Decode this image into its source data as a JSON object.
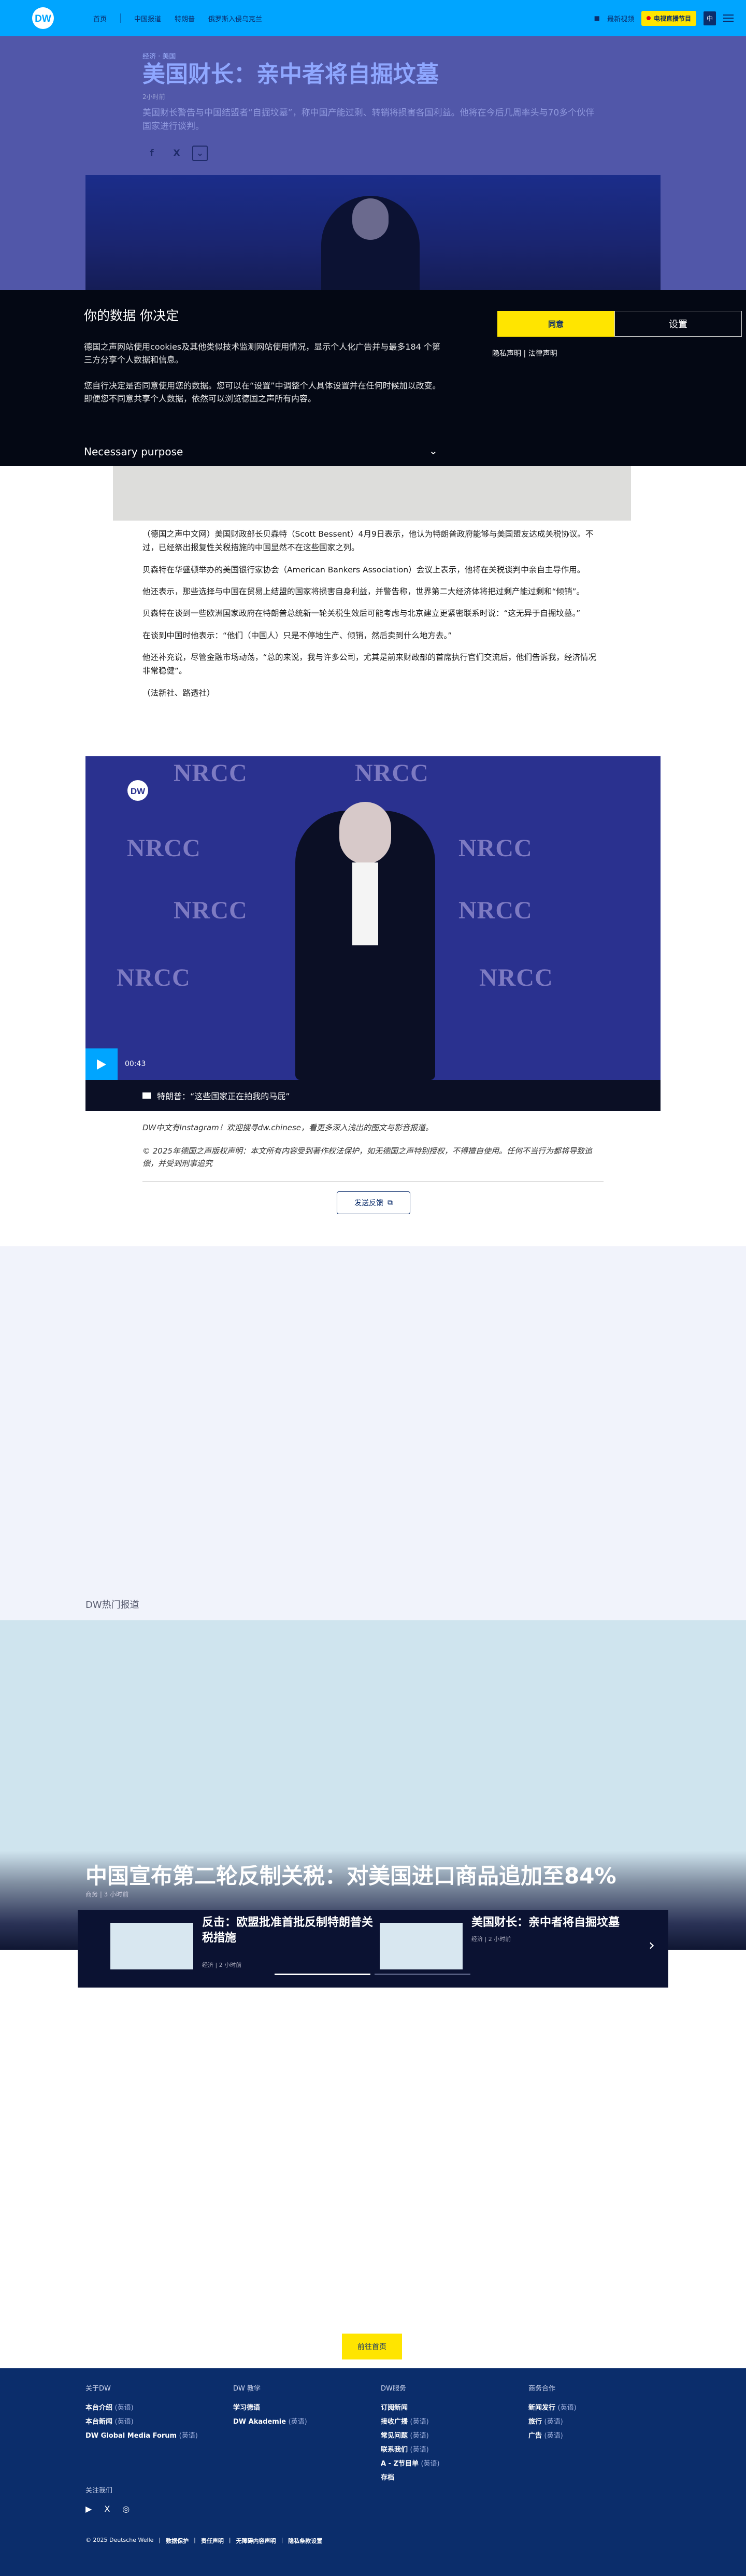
{
  "header": {
    "logo": "DW",
    "nav": [
      "首页",
      "中国报道",
      "特朗普",
      "俄罗斯入侵乌克兰"
    ],
    "featured_label": "最新视频",
    "live_label": "电视直播节目",
    "lang_label": "中"
  },
  "article": {
    "breadcrumb": "经济 · 美国",
    "title": "美国财长：亲中者将自掘坟墓",
    "date": "2小时前",
    "lead": "美国财长警告与中国结盟者“自掘坟墓”，称中国产能过剩、转销将损害各国利益。他将在今后几周率头与70多个伙伴国家进行谈判。",
    "share": [
      "f",
      "X",
      "⌄"
    ],
    "paragraphs": [
      "（德国之声中文网）美国财政部长贝森特（Scott Bessent）4月9日表示，他认为特朗普政府能够与美国盟友达成关税协议。不过，已经祭出报复性关税措施的中国显然不在这些国家之列。",
      "贝森特在华盛顿举办的美国银行家协会（American Bankers Association）会议上表示，他将在关税谈判中亲自主导作用。",
      "他还表示，那些选择与中国在贸易上结盟的国家将损害自身利益，并警告称，世界第二大经济体将把过剩产能过剩和“倾销”。",
      "贝森特在谈到一些欧洲国家政府在特朗普总统新一轮关税生效后可能考虑与北京建立更紧密联系时说：“这无异于自掘坟墓。”",
      "在谈到中国时他表示：“他们（中国人）只是不停地生产、倾销，然后卖到什么地方去。”",
      "他还补充说，尽管金融市场动荡，“总的来说，我与许多公司，尤其是前来财政部的首席执行官们交流后，他们告诉我，经济情况非常稳健”。",
      "（法新社、路透社）"
    ]
  },
  "cookie": {
    "title": "你的数据 你决定",
    "p1": "德国之声网站使用cookies及其他类似技术监测网站使用情况，显示个人化广告并与最多184 个第三方分享个人数据和信息。",
    "p2": "您自行决定是否同意使用您的数据。您可以在“设置”中调整个人具体设置并在任何时候加以改变。即便您不同意共享个人数据，依然可以浏览德国之声所有内容。",
    "purpose": "Necessary purpose",
    "accept": "同意",
    "settings": "设置",
    "links": "隐私声明 | 法律声明"
  },
  "video": {
    "time": "00:43",
    "caption": "特朗普：“这些国家正在拍我的马屁”",
    "backdrop": "NRCC"
  },
  "promo": "DW中文有Instagram！欢迎搜寻dw.chinese，看更多深入浅出的图文与影音报道。",
  "copyright": "© 2025年德国之声版权声明：本文所有内容受到著作权法保护，如无德国之声特别授权，不得擅自使用。任何不当行为都将导致追偿，并受到刑事追究",
  "feedback_label": "发送反馈",
  "hot": {
    "label": "DW热门报道",
    "title": "中国宣布第二轮反制关税：对美国进口商品追加至84%",
    "meta": "商务 | 3 小时前",
    "cards": [
      {
        "title": "反击：欧盟批准首批反制特朗普关税措施",
        "meta": "经济 | 2 小时前"
      },
      {
        "title": "美国财长：亲中者将自掘坟墓",
        "meta": "经济 | 2 小时前"
      }
    ]
  },
  "home_label": "前往首页",
  "footer": {
    "cols": [
      {
        "head": "关于DW",
        "items": [
          {
            "b": "本台介绍",
            "t": "(英语)"
          },
          {
            "b": "本台新闻",
            "t": "(英语)"
          },
          {
            "b": "DW Global Media Forum",
            "t": "(英语)"
          }
        ]
      },
      {
        "head": "DW 教学",
        "items": [
          {
            "b": "学习德语",
            "t": ""
          },
          {
            "b": "DW Akademie",
            "t": "(英语)"
          }
        ]
      },
      {
        "head": "DW服务",
        "items": [
          {
            "b": "订阅新闻",
            "t": ""
          },
          {
            "b": "接收广播",
            "t": "(英语)"
          },
          {
            "b": "常见问题",
            "t": "(英语)"
          },
          {
            "b": "联系我们",
            "t": "(英语)"
          },
          {
            "b": "A - Z节目单",
            "t": "(英语)"
          },
          {
            "b": "存档",
            "t": ""
          }
        ]
      },
      {
        "head": "商务合作",
        "items": [
          {
            "b": "新闻发行",
            "t": "(英语)"
          },
          {
            "b": "旅行",
            "t": "(英语)"
          },
          {
            "b": "广告",
            "t": "(英语)"
          }
        ]
      }
    ],
    "follow": "关注我们",
    "social": [
      "▶",
      "X",
      "◎"
    ],
    "legal": [
      "© 2025 Deutsche Welle",
      "数据保护",
      "责任声明",
      "无障碍内容声明",
      "隐私条款设置"
    ]
  }
}
